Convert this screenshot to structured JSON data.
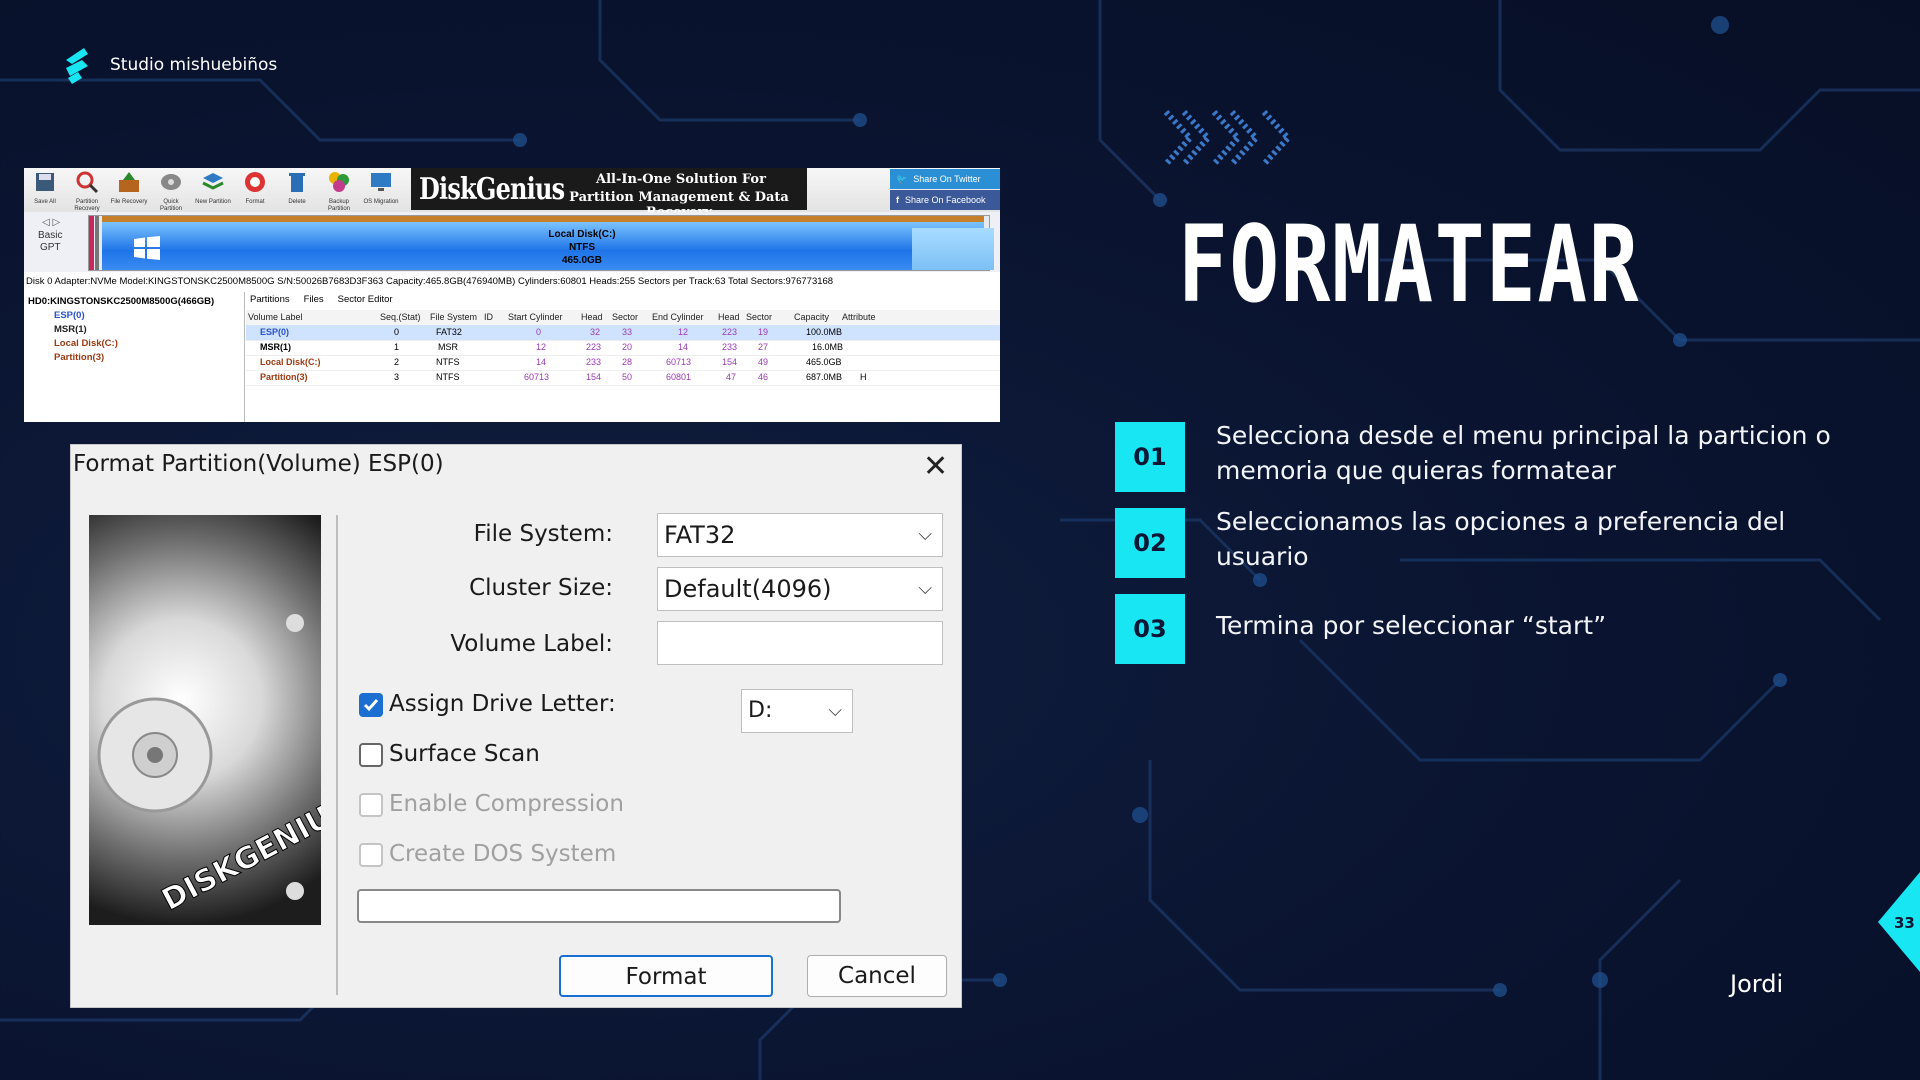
{
  "brand": {
    "name": "Studio mishuebiños",
    "logo_icon": "lightning-s-icon",
    "accent": "#18e6f3"
  },
  "slide": {
    "title": "FORMATEAR",
    "author": "Jordi",
    "page_number": "33"
  },
  "steps": [
    {
      "num": "01",
      "text": "Selecciona desde el menu principal  la particion o memoria que quieras formatear"
    },
    {
      "num": "02",
      "text": "Seleccionamos las opciones  a preferencia del usuario"
    },
    {
      "num": "03",
      "text": "Termina por seleccionar “start”"
    }
  ],
  "diskgenius": {
    "toolbar": [
      "Save All",
      "Partition Recovery",
      "File Recovery",
      "Quick Partition",
      "New Partition",
      "Format",
      "Delete",
      "Backup Partition",
      "OS Migration"
    ],
    "banner": {
      "logo": "DiskGenius",
      "tagline1": "All-In-One Solution For",
      "tagline2": "Partition Management & Data Recovery"
    },
    "share": {
      "twitter": "Share On Twitter",
      "facebook": "Share On Facebook"
    },
    "disk": {
      "type_line1": "Basic",
      "type_line2": "GPT",
      "volume": "Local Disk(C:)",
      "fs": "NTFS",
      "size": "465.0GB"
    },
    "info": "Disk 0 Adapter:NVMe  Model:KINGSTONSKC2500M8500G  S/N:50026B7683D3F363  Capacity:465.8GB(476940MB)  Cylinders:60801  Heads:255  Sectors per Track:63  Total Sectors:976773168",
    "tree": {
      "root": "HD0:KINGSTONSKC2500M8500G(466GB)",
      "items": [
        "ESP(0)",
        "MSR(1)",
        "Local Disk(C:)",
        "Partition(3)"
      ]
    },
    "tabs": [
      "Partitions",
      "Files",
      "Sector Editor"
    ],
    "columns": [
      "Volume Label",
      "Seq.(Stat)",
      "File System",
      "ID",
      "Start Cylinder",
      "Head",
      "Sector",
      "End Cylinder",
      "Head",
      "Sector",
      "Capacity",
      "Attribute"
    ],
    "rows": [
      [
        "ESP(0)",
        "0",
        "FAT32",
        "",
        "0",
        "32",
        "33",
        "12",
        "223",
        "19",
        "100.0MB",
        ""
      ],
      [
        "MSR(1)",
        "1",
        "MSR",
        "",
        "12",
        "223",
        "20",
        "14",
        "233",
        "27",
        "16.0MB",
        ""
      ],
      [
        "Local Disk(C:)",
        "2",
        "NTFS",
        "",
        "14",
        "233",
        "28",
        "60713",
        "154",
        "49",
        "465.0GB",
        ""
      ],
      [
        "Partition(3)",
        "3",
        "NTFS",
        "",
        "60713",
        "154",
        "50",
        "60801",
        "47",
        "46",
        "687.0MB",
        "H"
      ]
    ]
  },
  "dialog": {
    "title": "Format Partition(Volume) ESP(0)",
    "file_system_label": "File System:",
    "file_system_value": "FAT32",
    "cluster_size_label": "Cluster Size:",
    "cluster_size_value": "Default(4096)",
    "volume_label_label": "Volume Label:",
    "volume_label_value": "",
    "assign_drive_letter": "Assign Drive Letter:",
    "drive_letter": "D:",
    "surface_scan": "Surface Scan",
    "enable_compression": "Enable Compression",
    "create_dos": "Create DOS System",
    "format_button": "Format",
    "cancel_button": "Cancel",
    "image_text": "DISKGENIUS"
  }
}
